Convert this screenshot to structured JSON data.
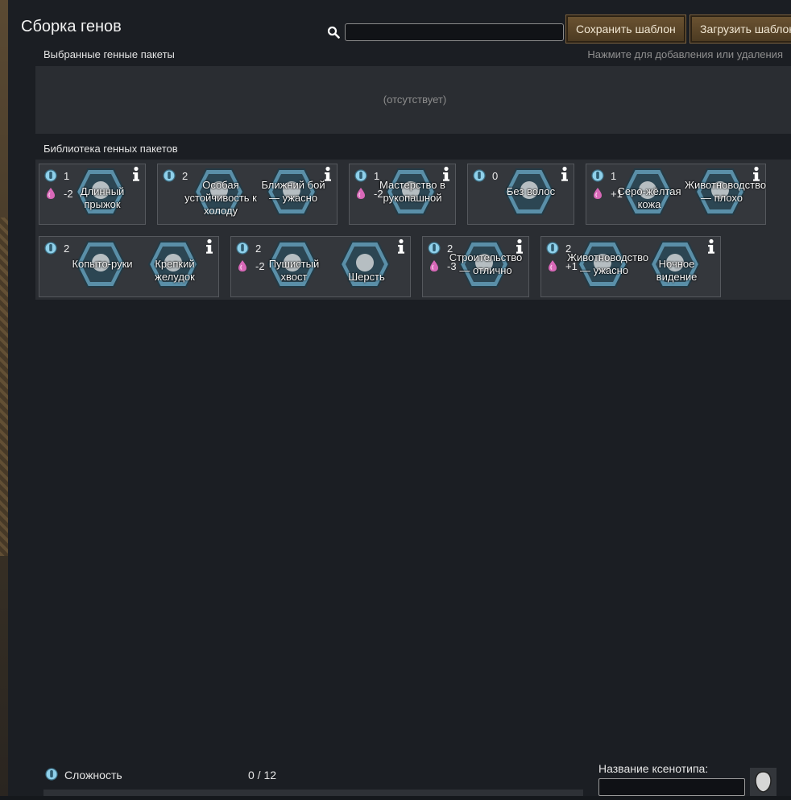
{
  "window": {
    "title": "Сборка генов"
  },
  "search": {
    "placeholder": "",
    "value": ""
  },
  "toolbar": {
    "save_label": "Сохранить шаблон",
    "load_label": "Загрузить шаблон"
  },
  "selected": {
    "label": "Выбранные генные пакеты",
    "hint": "Нажмите для добавления или удаления",
    "empty_text": "(отсутствует)"
  },
  "library": {
    "label": "Библиотека генных пакетов",
    "packs": [
      {
        "complexity": "1",
        "metabolism": "-2",
        "genes": [
          {
            "name": "Длинный прыжок",
            "icon": "long-jump-icon"
          }
        ]
      },
      {
        "complexity": "2",
        "metabolism": "",
        "genes": [
          {
            "name": "Особая устойчивость к холоду",
            "icon": "cold-resistance-icon"
          },
          {
            "name": "Ближний бой — ужасно",
            "icon": "melee-awful-icon"
          }
        ]
      },
      {
        "complexity": "1",
        "metabolism": "-2",
        "genes": [
          {
            "name": "Мастерство в рукопашной",
            "icon": "melee-mastery-icon"
          }
        ]
      },
      {
        "complexity": "0",
        "metabolism": "",
        "genes": [
          {
            "name": "Без волос",
            "icon": "no-hair-icon"
          }
        ]
      },
      {
        "complexity": "1",
        "metabolism": "+1",
        "genes": [
          {
            "name": "Серо-жёлтая кожа",
            "icon": "gray-yellow-skin-icon"
          },
          {
            "name": "Животноводство — плохо",
            "icon": "animals-poor-icon"
          }
        ]
      },
      {
        "complexity": "2",
        "metabolism": "",
        "genes": [
          {
            "name": "Копыто-руки",
            "icon": "hoof-hands-icon"
          },
          {
            "name": "Крепкий желудок",
            "icon": "strong-stomach-icon"
          }
        ]
      },
      {
        "complexity": "2",
        "metabolism": "-2",
        "genes": [
          {
            "name": "Пушистый хвост",
            "icon": "fluffy-tail-icon"
          },
          {
            "name": "Шерсть",
            "icon": "fur-icon"
          }
        ]
      },
      {
        "complexity": "2",
        "metabolism": "-3",
        "genes": [
          {
            "name": "Строительство — отлично",
            "icon": "construction-great-icon"
          }
        ]
      },
      {
        "complexity": "2",
        "metabolism": "+1",
        "genes": [
          {
            "name": "Животноводство — ужасно",
            "icon": "animals-awful-icon"
          },
          {
            "name": "Ночное видение",
            "icon": "night-vision-icon"
          }
        ]
      }
    ]
  },
  "footer": {
    "complexity_label": "Сложность",
    "complexity_value": "0 / 12",
    "xenotype_label": "Название ксенотипа:",
    "xenotype_value": ""
  },
  "colors": {
    "complexity": "#8fd0ea",
    "metabolism": "#d868b8",
    "button": "#5c4629",
    "hex_frame": "#5a8fa8"
  }
}
